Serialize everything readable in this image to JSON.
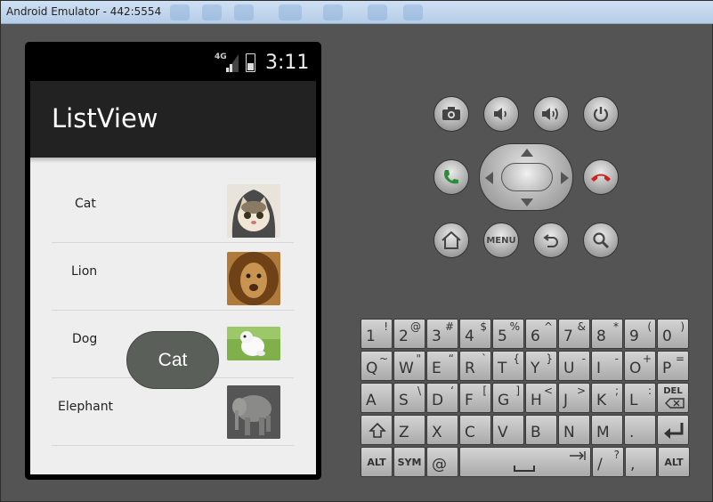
{
  "window": {
    "title": "Android Emulator - 442:5554"
  },
  "status_bar": {
    "network": "4G",
    "time": "3:11"
  },
  "app": {
    "title": "ListView"
  },
  "list": {
    "items": [
      {
        "label": "Cat",
        "image": "cat-photo"
      },
      {
        "label": "Lion",
        "image": "lion-photo"
      },
      {
        "label": "Dog",
        "image": "dog-photo"
      },
      {
        "label": "Elephant",
        "image": "elephant-photo"
      }
    ]
  },
  "toast": {
    "text": "Cat"
  },
  "hardware_buttons": {
    "camera": "camera-icon",
    "volume_down": "volume-down-icon",
    "volume_up": "volume-up-icon",
    "power": "power-icon",
    "call": "call-icon",
    "end_call": "end-call-icon",
    "home": "home-icon",
    "menu": "MENU",
    "back": "back-icon",
    "search": "search-icon"
  },
  "keyboard": {
    "row1": [
      [
        "1",
        "!"
      ],
      [
        "2",
        "@"
      ],
      [
        "3",
        "#"
      ],
      [
        "4",
        "$"
      ],
      [
        "5",
        "%"
      ],
      [
        "6",
        "^"
      ],
      [
        "7",
        "&"
      ],
      [
        "8",
        "*"
      ],
      [
        "9",
        "("
      ],
      [
        "0",
        ")"
      ]
    ],
    "row2": [
      [
        "Q",
        "~"
      ],
      [
        "W",
        "\""
      ],
      [
        "E",
        "“"
      ],
      [
        "R",
        "`"
      ],
      [
        "T",
        "{"
      ],
      [
        "Y",
        "}"
      ],
      [
        "U",
        "-"
      ],
      [
        "I",
        "-"
      ],
      [
        "O",
        "+"
      ],
      [
        "P",
        "="
      ]
    ],
    "row3": [
      [
        "A",
        ""
      ],
      [
        "S",
        "\\"
      ],
      [
        "D",
        "‘"
      ],
      [
        "F",
        "["
      ],
      [
        "G",
        "]"
      ],
      [
        "H",
        "<"
      ],
      [
        "J",
        ">"
      ],
      [
        "K",
        ";"
      ],
      [
        "L",
        ":"
      ],
      [
        "DEL",
        ""
      ]
    ],
    "row4": [
      [
        "shift",
        ""
      ],
      [
        "Z",
        ""
      ],
      [
        "X",
        ""
      ],
      [
        "C",
        ""
      ],
      [
        "V",
        ""
      ],
      [
        "B",
        ""
      ],
      [
        "N",
        ""
      ],
      [
        "M",
        ""
      ],
      [
        ".",
        ""
      ],
      [
        "enter",
        ""
      ]
    ],
    "row5": [
      [
        "ALT",
        ""
      ],
      [
        "SYM",
        ""
      ],
      [
        "@",
        ""
      ],
      [
        "space",
        ""
      ],
      [
        "/",
        "?"
      ],
      [
        ",",
        ""
      ],
      [
        "ALT",
        ""
      ]
    ]
  },
  "colors": {
    "action_bar": "#222222",
    "list_bg": "#eeeeee",
    "toast_bg": "#5b5f5a",
    "call_green": "#2e8b3a",
    "end_red": "#cc2222"
  }
}
